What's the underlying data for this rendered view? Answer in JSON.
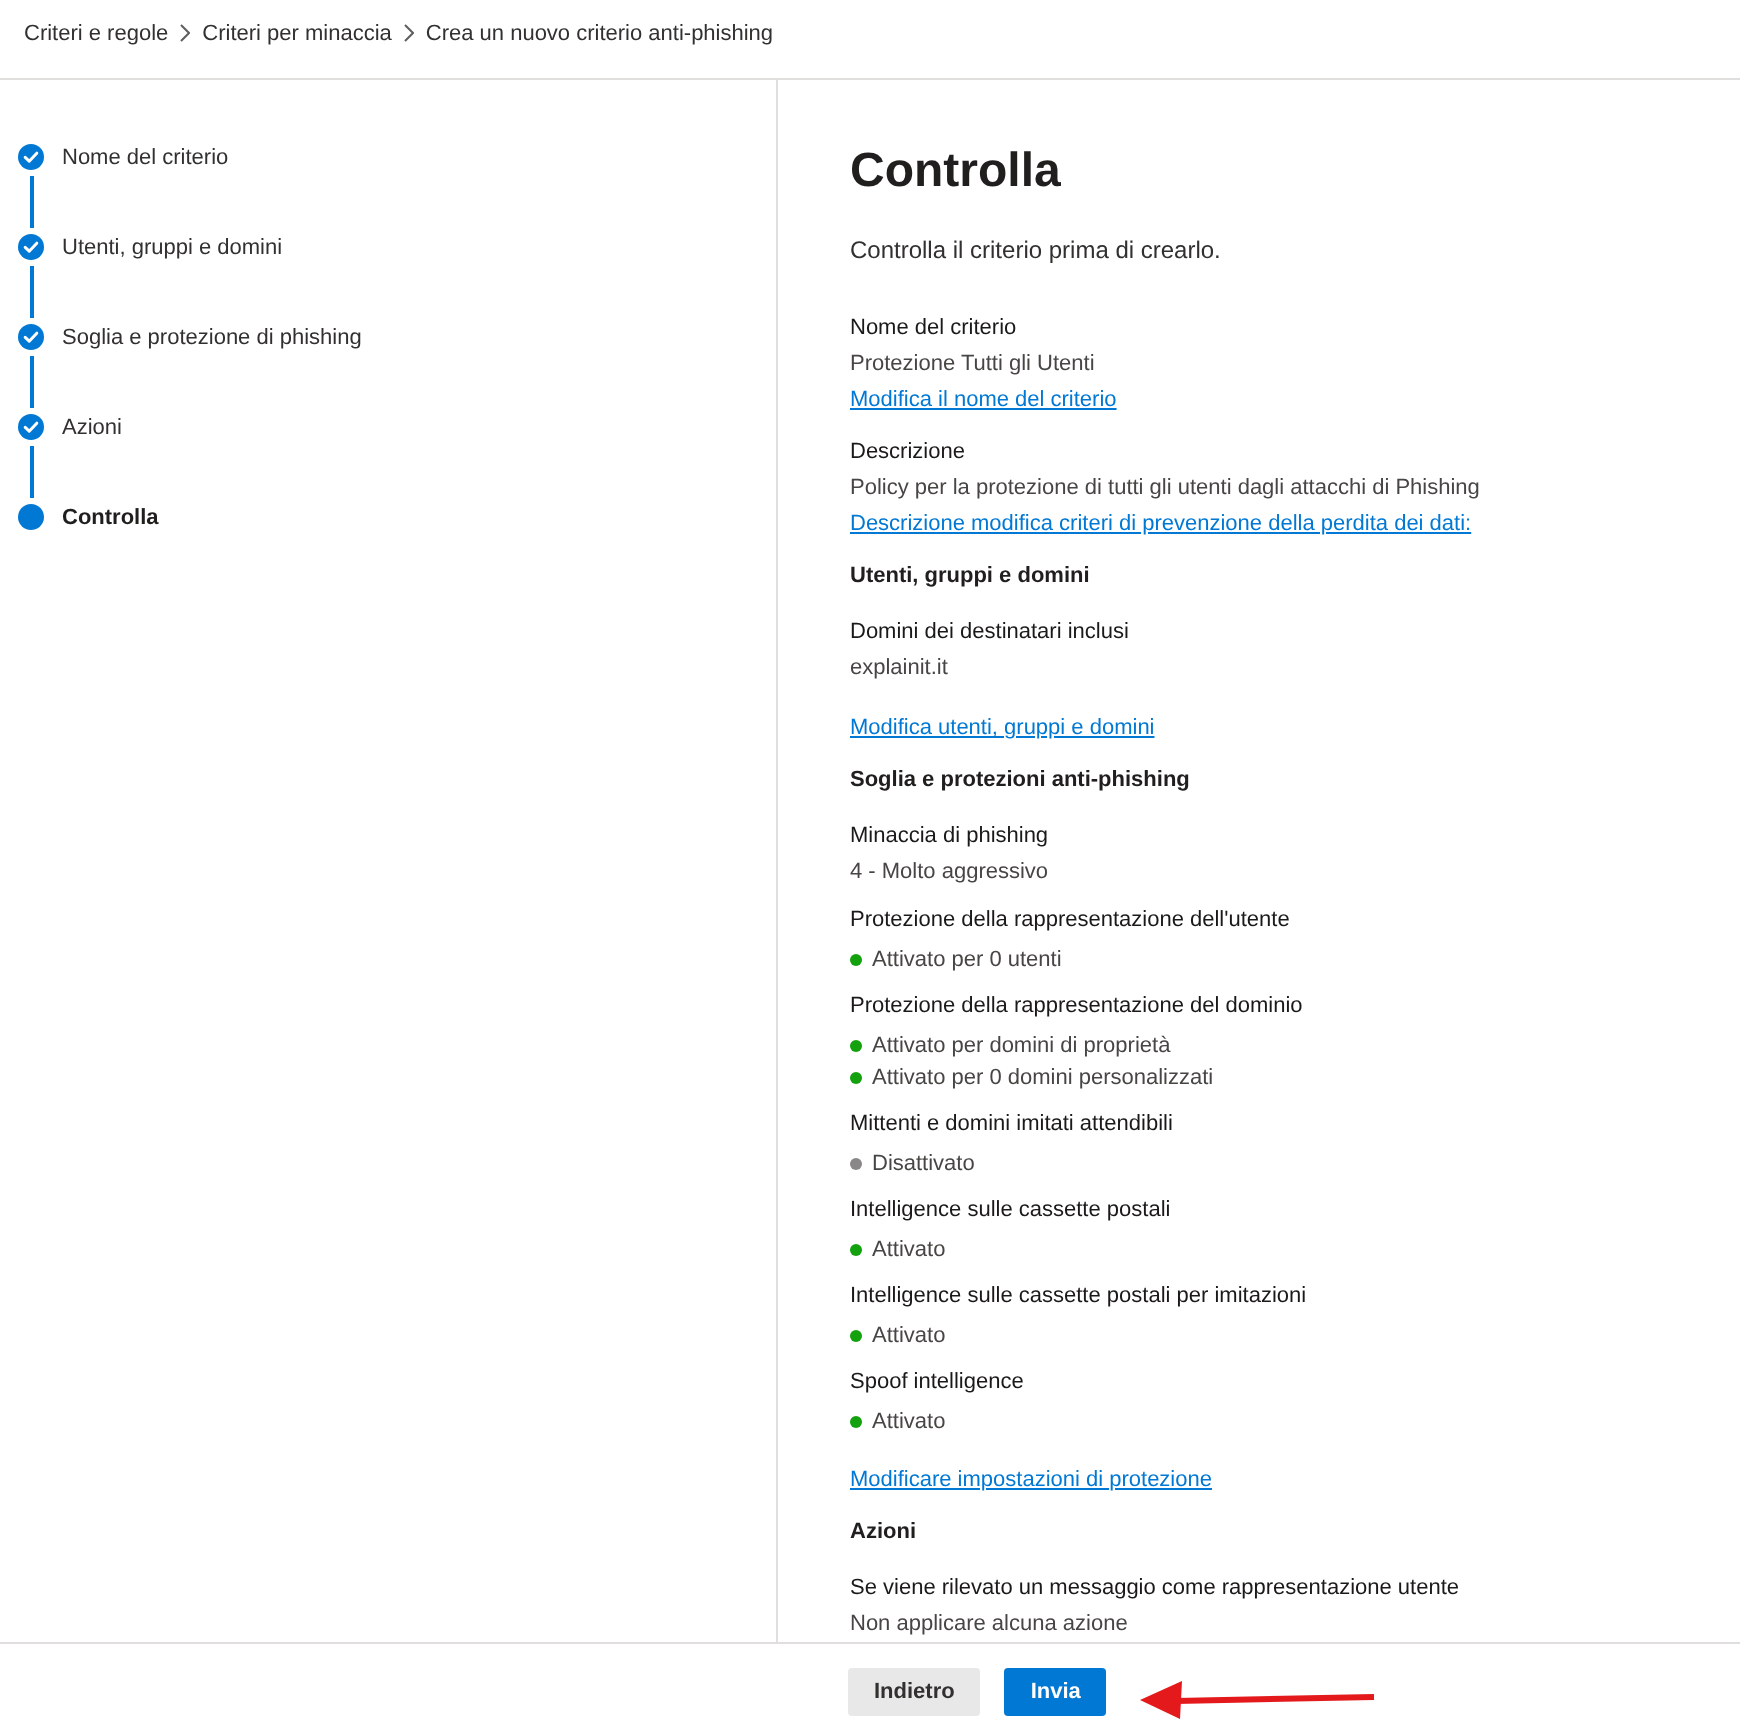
{
  "breadcrumb": [
    "Criteri e regole",
    "Criteri per minaccia",
    "Crea un nuovo criterio anti-phishing"
  ],
  "steps": [
    {
      "label": "Nome del criterio",
      "completed": true,
      "selected": false
    },
    {
      "label": "Utenti, gruppi e domini",
      "completed": true,
      "selected": false
    },
    {
      "label": "Soglia e protezione di phishing",
      "completed": true,
      "selected": false
    },
    {
      "label": "Azioni",
      "completed": true,
      "selected": false
    },
    {
      "label": "Controlla",
      "completed": false,
      "selected": true
    }
  ],
  "review": {
    "title": "Controlla",
    "intro": "Controlla il criterio prima di crearlo.",
    "sections": [
      {
        "fields": [
          {
            "kind": "text",
            "label": "Nome del criterio",
            "value": "Protezione Tutti gli Utenti"
          }
        ],
        "link": "Modifica il nome del criterio"
      },
      {
        "fields": [
          {
            "kind": "text",
            "label": "Descrizione",
            "value": "Policy per la protezione di tutti gli utenti dagli attacchi di Phishing"
          }
        ],
        "link": "Descrizione modifica criteri di prevenzione della perdita dei dati:"
      },
      {
        "heading": "Utenti, gruppi e domini",
        "fields": [
          {
            "kind": "text",
            "label": "Domini dei destinatari inclusi",
            "value": "explainit.it"
          }
        ],
        "link": "Modifica utenti, gruppi e domini"
      },
      {
        "heading": "Soglia e protezioni anti-phishing",
        "fields": [
          {
            "kind": "text",
            "label": "Minaccia di phishing",
            "value": "4 - Molto aggressivo"
          },
          {
            "kind": "status",
            "label": "Protezione della rappresentazione dell'utente",
            "statuses": [
              {
                "text": "Attivato per 0 utenti",
                "color": "#13a10e"
              }
            ]
          },
          {
            "kind": "status",
            "label": "Protezione della rappresentazione del dominio",
            "statuses": [
              {
                "text": "Attivato per domini di proprietà",
                "color": "#13a10e"
              },
              {
                "text": "Attivato per 0 domini personalizzati",
                "color": "#13a10e"
              }
            ]
          },
          {
            "kind": "status",
            "label": "Mittenti e domini imitati attendibili",
            "statuses": [
              {
                "text": "Disattivato",
                "color": "#8a8886"
              }
            ]
          },
          {
            "kind": "status",
            "label": "Intelligence sulle cassette postali",
            "statuses": [
              {
                "text": "Attivato",
                "color": "#13a10e"
              }
            ]
          },
          {
            "kind": "status",
            "label": "Intelligence sulle cassette postali per imitazioni",
            "statuses": [
              {
                "text": "Attivato",
                "color": "#13a10e"
              }
            ]
          },
          {
            "kind": "status",
            "label": "Spoof intelligence",
            "statuses": [
              {
                "text": "Attivato",
                "color": "#13a10e"
              }
            ]
          }
        ],
        "link": "Modificare impostazioni di protezione"
      },
      {
        "heading": "Azioni",
        "fields": [
          {
            "kind": "text",
            "label": "Se viene rilevato un messaggio come rappresentazione utente",
            "value": "Non applicare alcuna azione"
          }
        ]
      }
    ]
  },
  "buttons": [
    {
      "label": "Indietro",
      "kind": "secondary"
    },
    {
      "label": "Invia",
      "kind": "primary"
    }
  ]
}
